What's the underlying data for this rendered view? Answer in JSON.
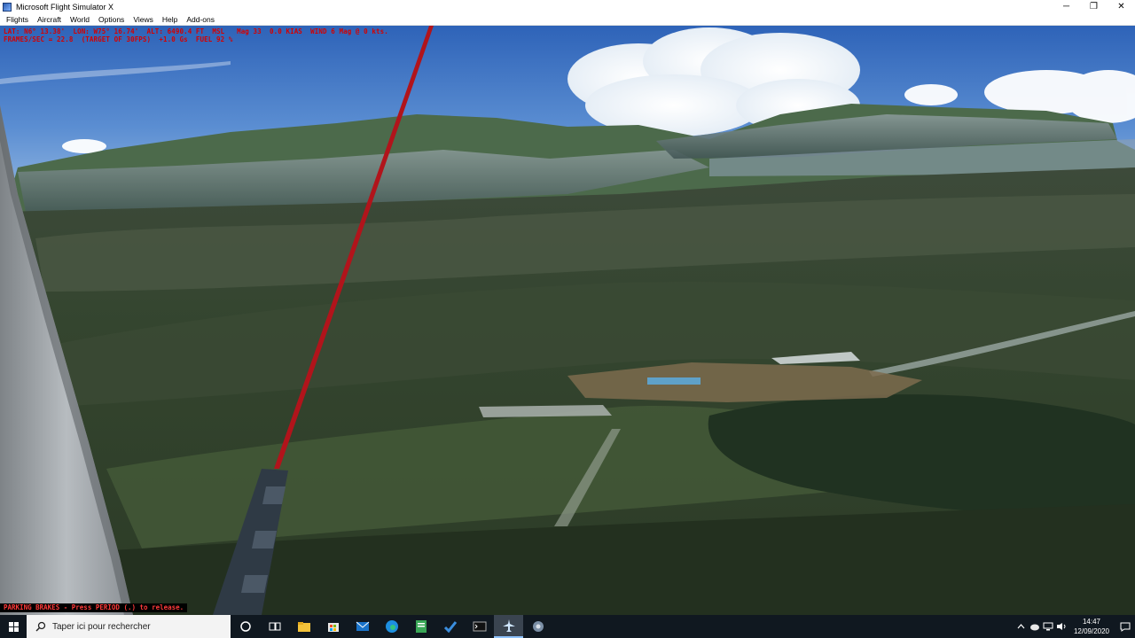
{
  "window": {
    "title": "Microsoft Flight Simulator X",
    "minimize": "─",
    "maximize": "❐",
    "close": "✕"
  },
  "menu": {
    "items": [
      "Flights",
      "Aircraft",
      "World",
      "Options",
      "Views",
      "Help",
      "Add-ons"
    ]
  },
  "hud": {
    "line1": "LAT: N6° 13.38'  LON: W75° 16.74'  ALT: 6490.4 FT  MSL   Mag 33  0.0 KIAS  WIND 6 Mag @ 0 kts.",
    "line2": "FRAMES/SEC = 22.8  (TARGET OF 30FPS)  +1.0 Gs  FUEL 92 %"
  },
  "status_message": "PARKING BRAKES - Press PERIOD (.) to release.",
  "taskbar": {
    "search_placeholder": "Taper ici pour rechercher",
    "time": "14:47",
    "date": "12/09/2020",
    "apps": [
      "cortana-icon",
      "task-view-icon",
      "file-explorer-icon",
      "store-icon",
      "mail-icon",
      "edge-icon",
      "notepad-icon",
      "todo-icon",
      "terminal-icon",
      "flight-simulator-icon",
      "settings-app-icon"
    ]
  },
  "colors": {
    "hud_text": "#d40000",
    "parking_text": "#ff3a3a",
    "taskbar": "#101820"
  }
}
